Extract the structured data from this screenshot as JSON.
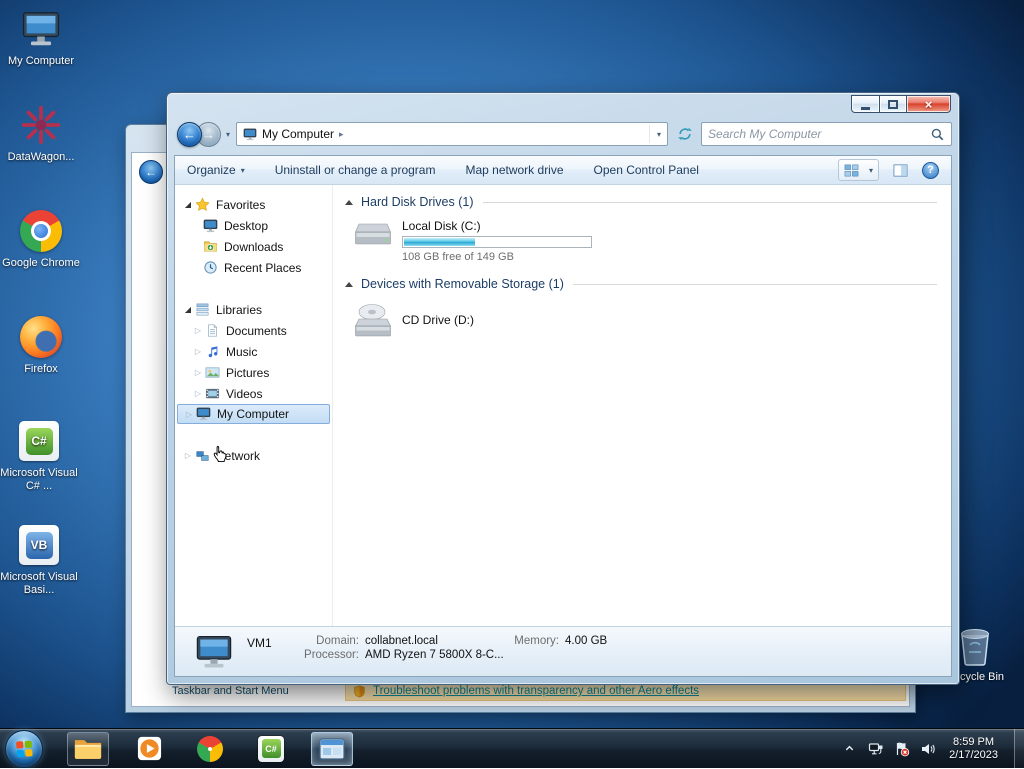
{
  "colors": {
    "selection_highlight": "#c2ddf5",
    "capacity_fill": "#2aa8d4",
    "close_button": "#d8442f",
    "desktop_blue": "#3b7fc2"
  },
  "desktop": {
    "icons": [
      {
        "label": "My Computer"
      },
      {
        "label": "DataWagon..."
      },
      {
        "label": "Google Chrome"
      },
      {
        "label": "Firefox"
      },
      {
        "label": "Microsoft Visual C# ..."
      },
      {
        "label": "Microsoft Visual Basi..."
      },
      {
        "label": "Recycle Bin"
      }
    ]
  },
  "background_window": {
    "taskbar_link": "Taskbar and Start Menu",
    "aero_link": "Troubleshoot problems with transparency and other Aero effects"
  },
  "explorer": {
    "breadcrumb": {
      "location": "My Computer"
    },
    "search": {
      "placeholder": "Search My Computer"
    },
    "toolbar": {
      "organize": "Organize",
      "uninstall": "Uninstall or change a program",
      "map_drive": "Map network drive",
      "open_control_panel": "Open Control Panel"
    },
    "sidebar": {
      "favorites": {
        "label": "Favorites",
        "items": [
          {
            "label": "Desktop"
          },
          {
            "label": "Downloads"
          },
          {
            "label": "Recent Places"
          }
        ]
      },
      "libraries": {
        "label": "Libraries",
        "items": [
          {
            "label": "Documents"
          },
          {
            "label": "Music"
          },
          {
            "label": "Pictures"
          },
          {
            "label": "Videos"
          }
        ]
      },
      "computer": {
        "label": "My Computer"
      },
      "network": {
        "label": "Network"
      }
    },
    "groups": [
      {
        "title": "Hard Disk Drives (1)"
      },
      {
        "title": "Devices with Removable Storage (1)"
      }
    ],
    "local_disk": {
      "label": "Local Disk (C:)",
      "free_text": "108 GB free of 149 GB",
      "used_percent": 38
    },
    "cd_drive": {
      "label": "CD Drive (D:)"
    },
    "details": {
      "computer_name": "VM1",
      "domain_label": "Domain:",
      "domain_value": "collabnet.local",
      "memory_label": "Memory:",
      "memory_value": "4.00 GB",
      "processor_label": "Processor:",
      "processor_value": "AMD Ryzen 7 5800X 8-C..."
    }
  },
  "taskbar": {
    "clock": {
      "time": "8:59 PM",
      "date": "2/17/2023"
    }
  }
}
